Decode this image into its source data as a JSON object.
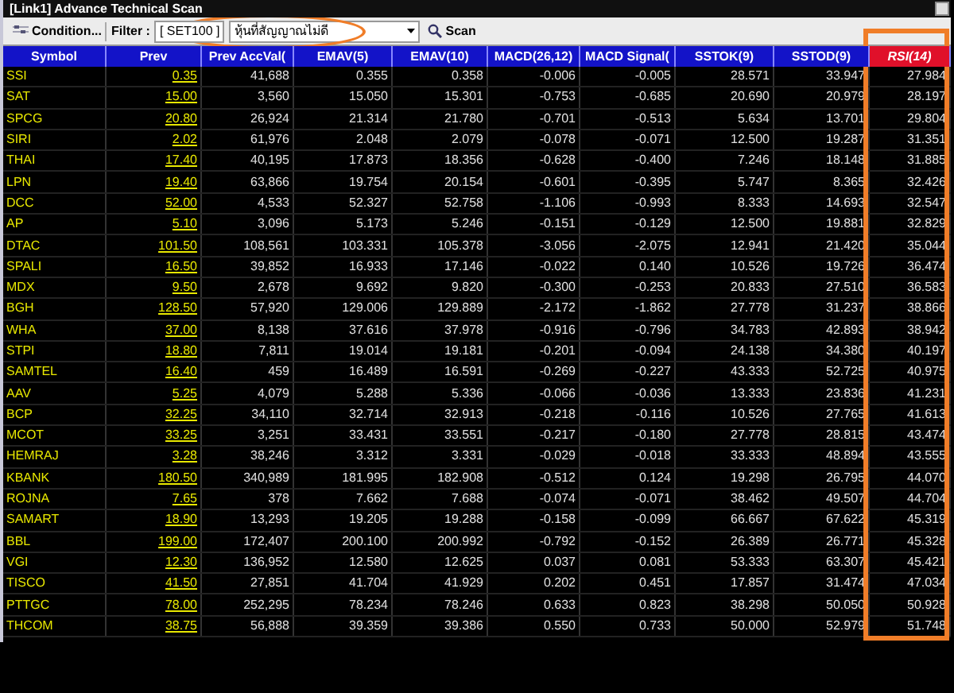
{
  "window": {
    "title": "[Link1] Advance Technical Scan"
  },
  "toolbar": {
    "condition_button": "Condition...",
    "filter_label": "Filter :",
    "filter_value": "[ SET100 ]",
    "preset": "หุ้นที่สัญญาณไม่ดี",
    "scan_button": "Scan"
  },
  "table": {
    "columns": [
      {
        "label": "Symbol",
        "sorted": false
      },
      {
        "label": "Prev",
        "sorted": false
      },
      {
        "label": "Prev AccVal(",
        "sorted": false
      },
      {
        "label": "EMAV(5)",
        "sorted": false
      },
      {
        "label": "EMAV(10)",
        "sorted": false
      },
      {
        "label": "MACD(26,12)",
        "sorted": false
      },
      {
        "label": "MACD Signal(",
        "sorted": false
      },
      {
        "label": "SSTOK(9)",
        "sorted": false
      },
      {
        "label": "SSTOD(9)",
        "sorted": false
      },
      {
        "label": "RSI(14)",
        "sorted": true
      }
    ],
    "rows": [
      [
        "SSI",
        "0.35",
        "41,688",
        "0.355",
        "0.358",
        "-0.006",
        "-0.005",
        "28.571",
        "33.947",
        "27.984"
      ],
      [
        "SAT",
        "15.00",
        "3,560",
        "15.050",
        "15.301",
        "-0.753",
        "-0.685",
        "20.690",
        "20.979",
        "28.197"
      ],
      [
        "SPCG",
        "20.80",
        "26,924",
        "21.314",
        "21.780",
        "-0.701",
        "-0.513",
        "5.634",
        "13.701",
        "29.804"
      ],
      [
        "SIRI",
        "2.02",
        "61,976",
        "2.048",
        "2.079",
        "-0.078",
        "-0.071",
        "12.500",
        "19.287",
        "31.351"
      ],
      [
        "THAI",
        "17.40",
        "40,195",
        "17.873",
        "18.356",
        "-0.628",
        "-0.400",
        "7.246",
        "18.148",
        "31.885"
      ],
      [
        "LPN",
        "19.40",
        "63,866",
        "19.754",
        "20.154",
        "-0.601",
        "-0.395",
        "5.747",
        "8.365",
        "32.426"
      ],
      [
        "DCC",
        "52.00",
        "4,533",
        "52.327",
        "52.758",
        "-1.106",
        "-0.993",
        "8.333",
        "14.693",
        "32.547"
      ],
      [
        "AP",
        "5.10",
        "3,096",
        "5.173",
        "5.246",
        "-0.151",
        "-0.129",
        "12.500",
        "19.881",
        "32.829"
      ],
      [
        "DTAC",
        "101.50",
        "108,561",
        "103.331",
        "105.378",
        "-3.056",
        "-2.075",
        "12.941",
        "21.420",
        "35.044"
      ],
      [
        "SPALI",
        "16.50",
        "39,852",
        "16.933",
        "17.146",
        "-0.022",
        "0.140",
        "10.526",
        "19.726",
        "36.474"
      ],
      [
        "MDX",
        "9.50",
        "2,678",
        "9.692",
        "9.820",
        "-0.300",
        "-0.253",
        "20.833",
        "27.510",
        "36.583"
      ],
      [
        "BGH",
        "128.50",
        "57,920",
        "129.006",
        "129.889",
        "-2.172",
        "-1.862",
        "27.778",
        "31.237",
        "38.866"
      ],
      [
        "WHA",
        "37.00",
        "8,138",
        "37.616",
        "37.978",
        "-0.916",
        "-0.796",
        "34.783",
        "42.893",
        "38.942"
      ],
      [
        "STPI",
        "18.80",
        "7,811",
        "19.014",
        "19.181",
        "-0.201",
        "-0.094",
        "24.138",
        "34.380",
        "40.197"
      ],
      [
        "SAMTEL",
        "16.40",
        "459",
        "16.489",
        "16.591",
        "-0.269",
        "-0.227",
        "43.333",
        "52.725",
        "40.975"
      ],
      [
        "AAV",
        "5.25",
        "4,079",
        "5.288",
        "5.336",
        "-0.066",
        "-0.036",
        "13.333",
        "23.836",
        "41.231"
      ],
      [
        "BCP",
        "32.25",
        "34,110",
        "32.714",
        "32.913",
        "-0.218",
        "-0.116",
        "10.526",
        "27.765",
        "41.613"
      ],
      [
        "MCOT",
        "33.25",
        "3,251",
        "33.431",
        "33.551",
        "-0.217",
        "-0.180",
        "27.778",
        "28.815",
        "43.474"
      ],
      [
        "HEMRAJ",
        "3.28",
        "38,246",
        "3.312",
        "3.331",
        "-0.029",
        "-0.018",
        "33.333",
        "48.894",
        "43.555"
      ],
      [
        "KBANK",
        "180.50",
        "340,989",
        "181.995",
        "182.908",
        "-0.512",
        "0.124",
        "19.298",
        "26.795",
        "44.070"
      ],
      [
        "ROJNA",
        "7.65",
        "378",
        "7.662",
        "7.688",
        "-0.074",
        "-0.071",
        "38.462",
        "49.507",
        "44.704"
      ],
      [
        "SAMART",
        "18.90",
        "13,293",
        "19.205",
        "19.288",
        "-0.158",
        "-0.099",
        "66.667",
        "67.622",
        "45.319"
      ],
      [
        "BBL",
        "199.00",
        "172,407",
        "200.100",
        "200.992",
        "-0.792",
        "-0.152",
        "26.389",
        "26.771",
        "45.328"
      ],
      [
        "VGI",
        "12.30",
        "136,952",
        "12.580",
        "12.625",
        "0.037",
        "0.081",
        "53.333",
        "63.307",
        "45.421"
      ],
      [
        "TISCO",
        "41.50",
        "27,851",
        "41.704",
        "41.929",
        "0.202",
        "0.451",
        "17.857",
        "31.474",
        "47.034"
      ],
      [
        "PTTGC",
        "78.00",
        "252,295",
        "78.234",
        "78.246",
        "0.633",
        "0.823",
        "38.298",
        "50.050",
        "50.928"
      ],
      [
        "THCOM",
        "38.75",
        "56,888",
        "39.359",
        "39.386",
        "0.550",
        "0.733",
        "50.000",
        "52.979",
        "51.748"
      ]
    ]
  }
}
